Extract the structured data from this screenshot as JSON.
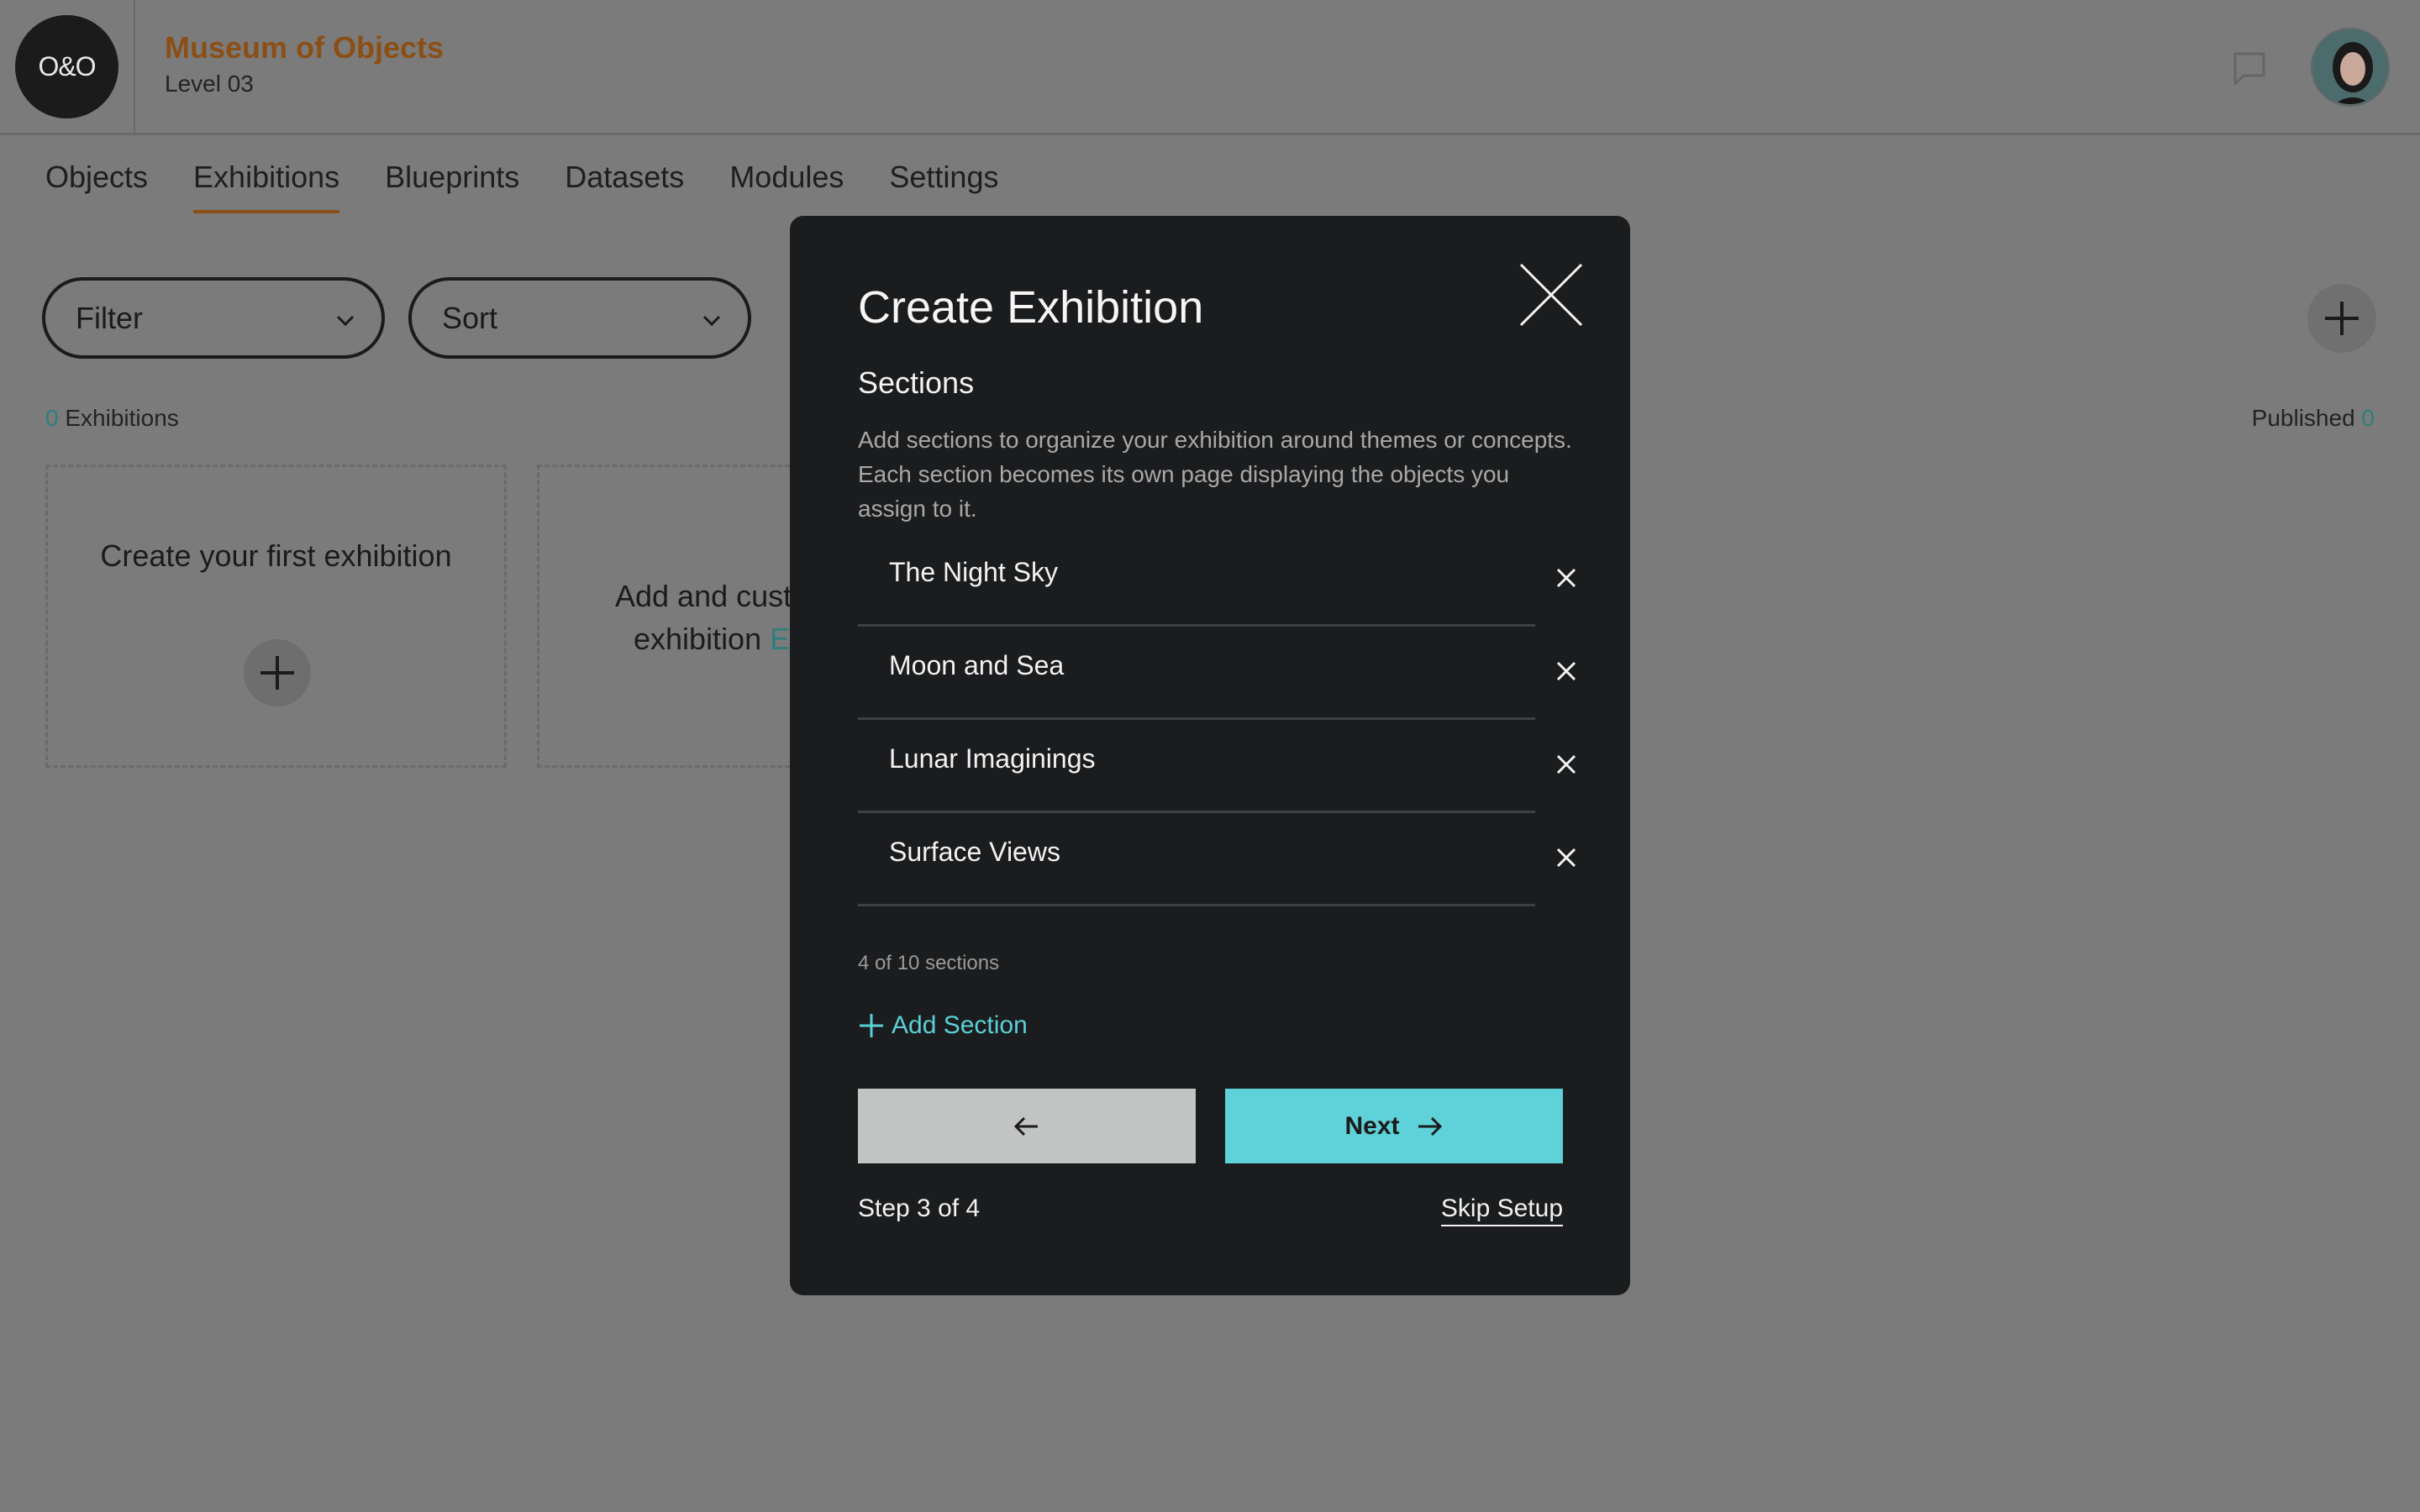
{
  "header": {
    "logo_text": "O&O",
    "title": "Museum of Objects",
    "subtitle": "Level 03",
    "icons": {
      "chat": "chat-bubble-icon",
      "avatar": "user-avatar"
    },
    "colors": {
      "brand": "#8b4f16",
      "accent": "#5ed2d8"
    }
  },
  "tabs": [
    {
      "label": "Objects",
      "active": false
    },
    {
      "label": "Exhibitions",
      "active": true
    },
    {
      "label": "Blueprints",
      "active": false
    },
    {
      "label": "Datasets",
      "active": false
    },
    {
      "label": "Modules",
      "active": false
    },
    {
      "label": "Settings",
      "active": false
    }
  ],
  "toolbar": {
    "filter_label": "Filter",
    "sort_label": "Sort"
  },
  "counts": {
    "exhibitions_value": "0",
    "exhibitions_label": "Exhibitions",
    "published_label": "Published",
    "published_value": "0"
  },
  "cards": {
    "create_first": "Create your first exhibition",
    "add_customize": "Add and cust",
    "add_customize_line2": "exhibition ",
    "add_customize_fragment": "E"
  },
  "modal": {
    "title": "Create Exhibition",
    "section_heading": "Sections",
    "description": "Add sections to organize your exhibition around themes or concepts. Each section becomes its own page displaying the objects you assign to it.",
    "sections": [
      {
        "name": "The Night Sky"
      },
      {
        "name": "Moon and Sea"
      },
      {
        "name": "Lunar Imaginings"
      },
      {
        "name": "Surface Views"
      }
    ],
    "section_count": "4 of 10 sections",
    "add_section_label": "Add Section",
    "next_label": "Next",
    "step_label": "Step 3 of 4",
    "skip_label": "Skip Setup"
  }
}
